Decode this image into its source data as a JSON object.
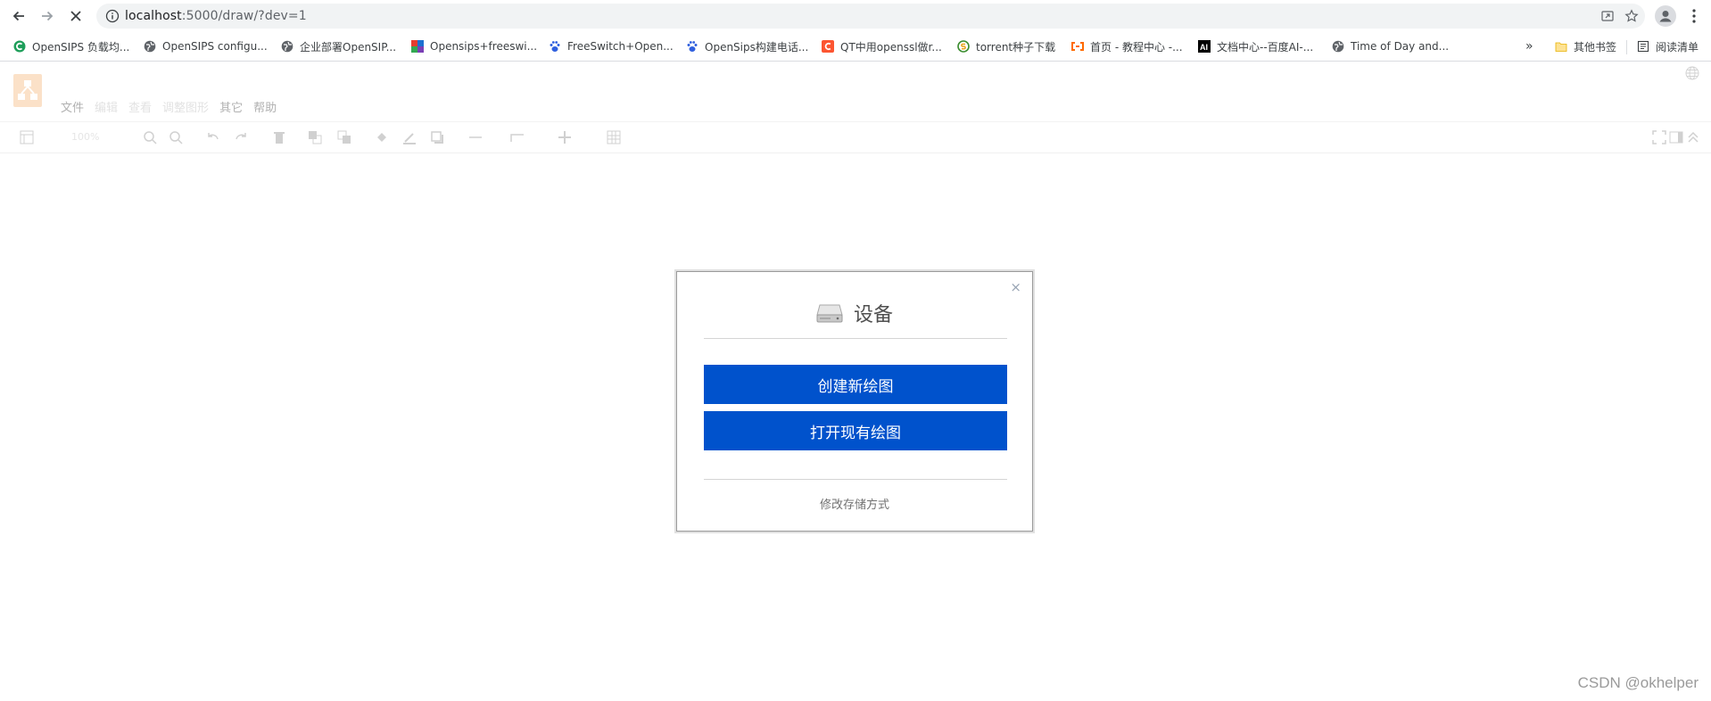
{
  "browser": {
    "url_host": "localhost",
    "url_rest": ":5000/draw/?dev=1",
    "bookmarks": [
      {
        "label": "OpenSIPS 负载均...",
        "icon": "green-c-favicon",
        "color": "#1e9e5a"
      },
      {
        "label": "OpenSIPS configu...",
        "icon": "globe-favicon",
        "color": "#5f6368"
      },
      {
        "label": "企业部署OpenSIP...",
        "icon": "globe-favicon",
        "color": "#5f6368"
      },
      {
        "label": "Opensips+freeswi...",
        "icon": "colorful-square-favicon",
        "color": "#7a3fb5"
      },
      {
        "label": "FreeSwitch+Open...",
        "icon": "baidu-paw-favicon",
        "color": "#2f5fde"
      },
      {
        "label": "OpenSips构建电话...",
        "icon": "baidu-paw-favicon",
        "color": "#2f5fde"
      },
      {
        "label": "QT中用openssl做r...",
        "icon": "csdn-c-favicon",
        "color": "#fc5531"
      },
      {
        "label": "torrent种子下载",
        "icon": "s-circle-favicon",
        "color": "#3b8d2f"
      },
      {
        "label": "首页 - 教程中心 -...",
        "icon": "aliyun-favicon",
        "color": "#ff6a00"
      },
      {
        "label": "文档中心--百度AI-...",
        "icon": "ai-favicon",
        "color": "#000000"
      },
      {
        "label": "Time of Day and...",
        "icon": "globe-favicon",
        "color": "#5f6368"
      }
    ],
    "overflow_label": "»",
    "other_bookmarks": "其他书签",
    "reading_list": "阅读清单"
  },
  "app": {
    "menu": [
      "文件",
      "编辑",
      "查看",
      "调整图形",
      "其它",
      "帮助"
    ],
    "zoom": "100%"
  },
  "dialog": {
    "title": "设备",
    "create_label": "创建新绘图",
    "open_label": "打开现有绘图",
    "storage_link": "修改存储方式",
    "close_symbol": "×",
    "accent": "#0052cc"
  },
  "watermark": "CSDN @okhelper"
}
